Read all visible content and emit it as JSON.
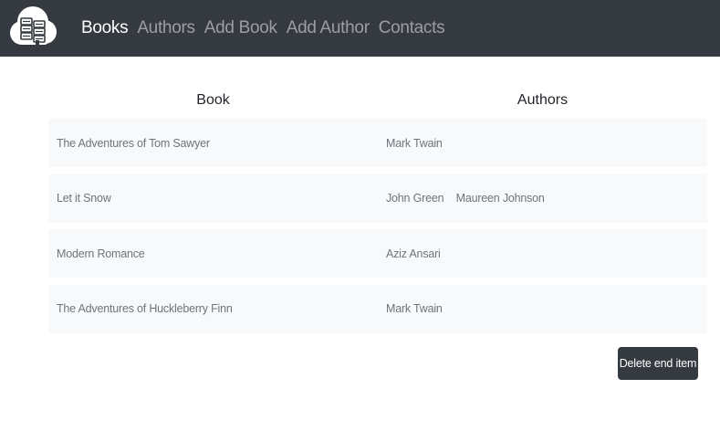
{
  "nav": {
    "logo_icon": "books-cloud-logo-icon",
    "links": [
      {
        "label": "Books",
        "active": true
      },
      {
        "label": "Authors",
        "active": false
      },
      {
        "label": "Add Book",
        "active": false
      },
      {
        "label": "Add Author",
        "active": false
      },
      {
        "label": "Contacts",
        "active": false
      }
    ]
  },
  "table": {
    "headers": {
      "book": "Book",
      "authors": "Authors"
    },
    "rows": [
      {
        "book": "The Adventures of Tom Sawyer",
        "authors": [
          "Mark Twain"
        ]
      },
      {
        "book": "Let it Snow",
        "authors": [
          "John Green",
          "Maureen Johnson"
        ]
      },
      {
        "book": "Modern Romance",
        "authors": [
          "Aziz Ansari"
        ]
      },
      {
        "book": "The Adventures of Huckleberry Finn",
        "authors": [
          "Mark Twain"
        ]
      }
    ]
  },
  "actions": {
    "delete_label": "Delete end item"
  },
  "colors": {
    "navbar_bg": "#343a40",
    "row_bg": "#f8f9fa",
    "button_bg": "#343a40"
  }
}
